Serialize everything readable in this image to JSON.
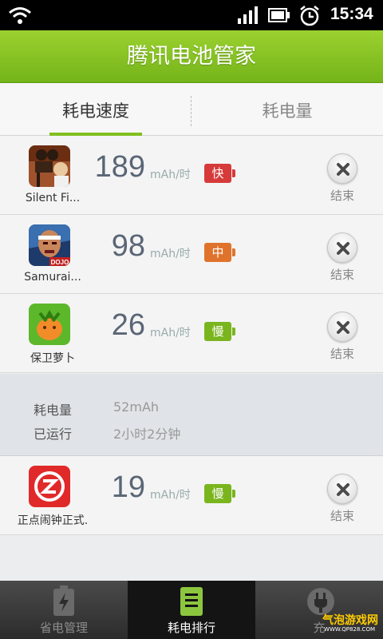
{
  "status_bar": {
    "time": "15:34",
    "icons": [
      "wifi-icon",
      "signal-icon",
      "battery-icon",
      "alarm-icon"
    ]
  },
  "header": {
    "title": "腾讯电池管家"
  },
  "tabs": [
    {
      "label": "耗电速度",
      "selected": true
    },
    {
      "label": "耗电量",
      "selected": false
    }
  ],
  "apps": [
    {
      "name": "Silent Fi...",
      "rate": "189",
      "unit": "mAh/时",
      "level": "快",
      "level_color": "#d63a3a",
      "end_label": "结束",
      "icon": "silent-film-app-icon"
    },
    {
      "name": "Samurai...",
      "rate": "98",
      "unit": "mAh/时",
      "level": "中",
      "level_color": "#e0732c",
      "end_label": "结束",
      "icon": "samurai-app-icon"
    },
    {
      "name": "保卫萝卜",
      "rate": "26",
      "unit": "mAh/时",
      "level": "慢",
      "level_color": "#7ab51e",
      "end_label": "结束",
      "icon": "carrot-app-icon"
    },
    {
      "name": "正点闹钟正式.",
      "rate": "19",
      "unit": "mAh/时",
      "level": "慢",
      "level_color": "#7ab51e",
      "end_label": "结束",
      "icon": "alarm-clock-app-icon"
    }
  ],
  "detail": {
    "consumption_label": "耗电量",
    "consumption_value": "52mAh",
    "runtime_label": "已运行",
    "runtime_value": "2小时2分钟"
  },
  "bottom_nav": [
    {
      "label": "省电管理",
      "icon": "battery-bolt-icon",
      "active": false
    },
    {
      "label": "耗电排行",
      "icon": "ranking-list-icon",
      "active": true
    },
    {
      "label": "充",
      "icon": "charging-plug-icon",
      "active": false
    }
  ],
  "watermark": {
    "main": "气泡游戏网",
    "sub": "WWW.QP828.COM"
  },
  "colors": {
    "accent": "#7fbf20",
    "header_green": "#86c225"
  }
}
